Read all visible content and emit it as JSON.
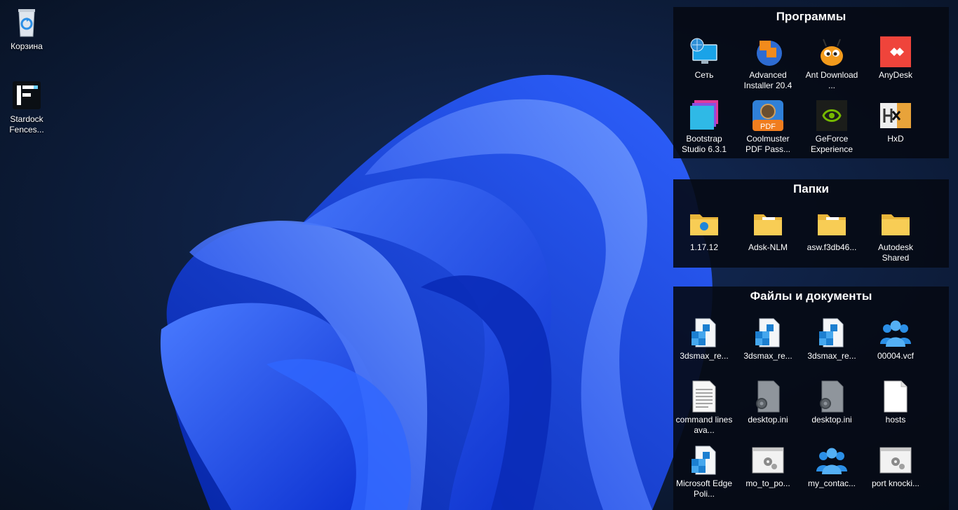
{
  "desktop": {
    "icons": [
      {
        "label": "Корзина",
        "icon": "recycle-bin-icon"
      },
      {
        "label": "Stardock Fences...",
        "icon": "stardock-fences-icon"
      }
    ]
  },
  "fences": {
    "programs": {
      "title": "Программы",
      "items": [
        {
          "label": "Сеть",
          "icon": "network-icon"
        },
        {
          "label": "Advanced Installer 20.4",
          "icon": "advanced-installer-icon"
        },
        {
          "label": "Ant Download ...",
          "icon": "ant-download-icon"
        },
        {
          "label": "AnyDesk",
          "icon": "anydesk-icon"
        },
        {
          "label": "Bootstrap Studio 6.3.1",
          "icon": "bootstrap-studio-icon"
        },
        {
          "label": "Coolmuster PDF Pass...",
          "icon": "coolmuster-pdf-icon"
        },
        {
          "label": "GeForce Experience",
          "icon": "geforce-icon"
        },
        {
          "label": "HxD",
          "icon": "hxd-icon"
        }
      ]
    },
    "folders": {
      "title": "Папки",
      "items": [
        {
          "label": "1.17.12",
          "icon": "folder-icon"
        },
        {
          "label": "Adsk-NLM",
          "icon": "folder-icon"
        },
        {
          "label": "asw.f3db46...",
          "icon": "folder-icon"
        },
        {
          "label": "Autodesk Shared",
          "icon": "folder-icon"
        }
      ]
    },
    "files": {
      "title": "Файлы и документы",
      "items": [
        {
          "label": "3dsmax_re...",
          "icon": "registry-file-icon"
        },
        {
          "label": "3dsmax_re...",
          "icon": "registry-file-icon"
        },
        {
          "label": "3dsmax_re...",
          "icon": "registry-file-icon"
        },
        {
          "label": "00004.vcf",
          "icon": "contact-file-icon"
        },
        {
          "label": "command lines ava...",
          "icon": "text-file-icon"
        },
        {
          "label": "desktop.ini",
          "icon": "settings-file-icon"
        },
        {
          "label": "desktop.ini",
          "icon": "settings-file-icon"
        },
        {
          "label": "hosts",
          "icon": "blank-file-icon"
        },
        {
          "label": "Microsoft Edge Poli...",
          "icon": "registry-file-icon"
        },
        {
          "label": "mo_to_po...",
          "icon": "config-window-icon"
        },
        {
          "label": "my_contac...",
          "icon": "contact-file-icon"
        },
        {
          "label": "port knocki...",
          "icon": "config-window-icon"
        }
      ]
    }
  }
}
